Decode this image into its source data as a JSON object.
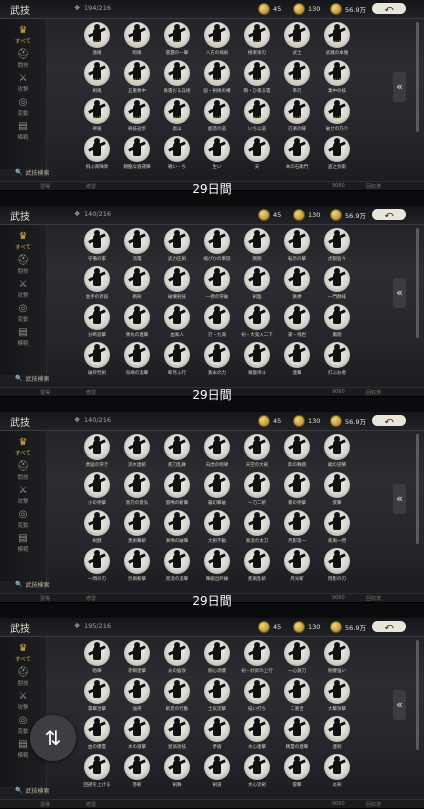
{
  "panels": [
    {
      "title": "武技",
      "count": "194/216",
      "jade": "45",
      "coins": "130",
      "gold": "56.9万",
      "timer": "29日間",
      "sidebar": [
        {
          "label": "すべて",
          "icon": "crown"
        },
        {
          "label": "闘技",
          "icon": "helmet"
        },
        {
          "label": "攻撃",
          "icon": "sword"
        },
        {
          "label": "変動",
          "icon": "swirl"
        },
        {
          "label": "模範",
          "icon": "book"
        }
      ],
      "search": "武技検索",
      "bottom": [
        "習得",
        "修習",
        "9060",
        "回収済"
      ],
      "rows": [
        [
          "遠眼",
          "暗眼",
          "雷霆の一撃",
          "八方の飛剣",
          "極楽浄刃",
          "武士",
          "武蔵の本懐"
        ],
        [
          "剣風",
          "五重奏中",
          "真雷だる兵術",
          "殴・剣術の構",
          "鞘・ひ夜る雲",
          "革刃",
          "業中の技"
        ],
        [
          "神速",
          "奇技返歩",
          "奥山",
          "鹿苑の盗",
          "いち以道",
          "刃楽の縁",
          "破せの乃り"
        ],
        [
          "飛ぶ真陣衆",
          "朝臨な道運陣",
          "戦い・ち",
          "生い",
          "天",
          "本の石衛門",
          "盗之弥衛"
        ]
      ]
    },
    {
      "title": "武技",
      "count": "140/216",
      "jade": "45",
      "coins": "130",
      "gold": "56.9万",
      "timer": "29日間",
      "sidebar": [
        {
          "label": "すべて",
          "icon": "crown"
        },
        {
          "label": "闘技",
          "icon": "helmet"
        },
        {
          "label": "攻撃",
          "icon": "sword"
        },
        {
          "label": "変動",
          "icon": "swirl"
        },
        {
          "label": "模範",
          "icon": "book"
        }
      ],
      "search": "武技検索",
      "bottom": [
        "習得",
        "修習",
        "9060",
        "回収済"
      ],
      "rows": [
        [
          "守備の家",
          "流電",
          "武力圧剣",
          "縮ぴかの軍獄",
          "剛剛",
          "転奈の撃",
          "虎狼猛々"
        ],
        [
          "金手の斉殺",
          "鞘剣",
          "破壊剣技",
          "一揆の突破",
          "剣盤",
          "鉄弾",
          "一門群緋"
        ],
        [
          "分断追撃",
          "弾丸の連撃",
          "血風人",
          "刃・九海",
          "剣・大鬼入二下",
          "豪・飛岩",
          "鳳翔"
        ],
        [
          "破砕烈剣",
          "烏鳩の追撃",
          "断月ふ行",
          "紫永の力",
          "報復待斗",
          "連撃",
          "打ぶお者"
        ]
      ]
    },
    {
      "title": "武技",
      "count": "140/216",
      "jade": "45",
      "coins": "130",
      "gold": "56.9万",
      "timer": "29日間",
      "sidebar": [
        {
          "label": "すべて",
          "icon": "crown"
        },
        {
          "label": "闘技",
          "icon": "helmet"
        },
        {
          "label": "攻撃",
          "icon": "sword"
        },
        {
          "label": "変動",
          "icon": "swirl"
        },
        {
          "label": "模範",
          "icon": "book"
        }
      ],
      "search": "武技検索",
      "bottom": [
        "習得",
        "修習",
        "9060",
        "回収済"
      ],
      "rows": [
        [
          "勇猛の突き",
          "流水連斬",
          "疾刀乱舞",
          "白虎の咆哮",
          "天空の大剣",
          "影の舞踏",
          "龍の逆鱗"
        ],
        [
          "小の突撃",
          "黒刃の意気",
          "雷鳴の斬撃",
          "霧幻撃破",
          "一刀二斬",
          "暴の突撃",
          "疾撃"
        ],
        [
          "剣獣",
          "黒術撃斬",
          "漸鳴の破陣",
          "大剣不動",
          "風流の太刀",
          "月影第一",
          "疾風一閃"
        ],
        [
          "一閃の刃",
          "烈風斬撃",
          "黒流の追撃",
          "陣脇出砕線",
          "疾風乱斬",
          "月光斬",
          "閃影の刃"
        ]
      ]
    },
    {
      "title": "武技",
      "count": "195/216",
      "jade": "45",
      "coins": "130",
      "gold": "56.9万",
      "timer": "",
      "sidebar": [
        {
          "label": "すべて",
          "icon": "crown"
        },
        {
          "label": "闘技",
          "icon": "helmet"
        },
        {
          "label": "攻撃",
          "icon": "sword"
        },
        {
          "label": "変動",
          "icon": "swirl"
        },
        {
          "label": "模範",
          "icon": "book"
        }
      ],
      "search": "武技検索",
      "bottom": [
        "習得",
        "修習",
        "9060",
        "回収済"
      ],
      "rows": [
        [
          "防陣",
          "赤銅連撃",
          "炎の猛攻",
          "剛心渦爆",
          "剣・砂昇の上行",
          "一心鉄刀",
          "剛健強い"
        ],
        [
          "雷撃治撃",
          "強突",
          "斬足の行動",
          "土気流撃",
          "描い打ち",
          "二重舌",
          "大撃攻撃"
        ],
        [
          "血の爆霊",
          "水の道撃",
          "星翁攻技",
          "矛盾",
          "水心連撃",
          "精霊の連撃",
          "連剣"
        ],
        [
          "回避を上げる",
          "巻斬",
          "剣舞",
          "剣道",
          "水心流剣",
          "雷撃",
          "炎剣"
        ]
      ]
    }
  ],
  "fab": {
    "icon": "swap-vertical-icon",
    "glyph": "⇅"
  }
}
